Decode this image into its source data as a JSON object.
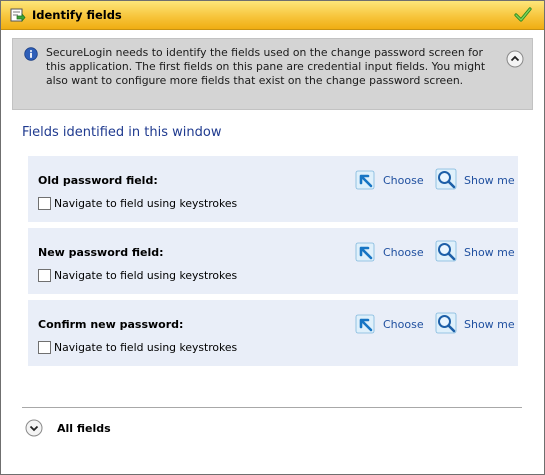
{
  "titlebar": {
    "title": "Identify fields",
    "icon": "form-arrow-icon",
    "confirm_icon": "green-check-icon"
  },
  "info": {
    "icon": "info-icon",
    "text": "SecureLogin needs to identify the fields used on the change password screen for this application. The first fields on this pane are credential input fields. You might also want to configure more fields that exist on the change password screen.",
    "collapse_icon": "chevron-up-circle-icon"
  },
  "section": {
    "title": "Fields identified in this window"
  },
  "fields": [
    {
      "label": "Old password field:",
      "checkbox_label": "Navigate to field using keystrokes",
      "checked": false,
      "choose_label": "Choose",
      "show_label": "Show me"
    },
    {
      "label": "New password field:",
      "checkbox_label": "Navigate to field using keystrokes",
      "checked": false,
      "choose_label": "Choose",
      "show_label": "Show me"
    },
    {
      "label": "Confirm new password:",
      "checkbox_label": "Navigate to field using keystrokes",
      "checked": false,
      "choose_label": "Choose",
      "show_label": "Show me"
    }
  ],
  "all_fields": {
    "label": "All fields",
    "expand_icon": "chevron-down-circle-icon"
  },
  "colors": {
    "titlebar_top": "#fde67a",
    "titlebar_bottom": "#f0ad12",
    "section_title": "#1f3a8f",
    "link": "#1f4f9f",
    "field_block_bg": "#e9eef8",
    "infobox_bg": "#d4d4d4"
  }
}
